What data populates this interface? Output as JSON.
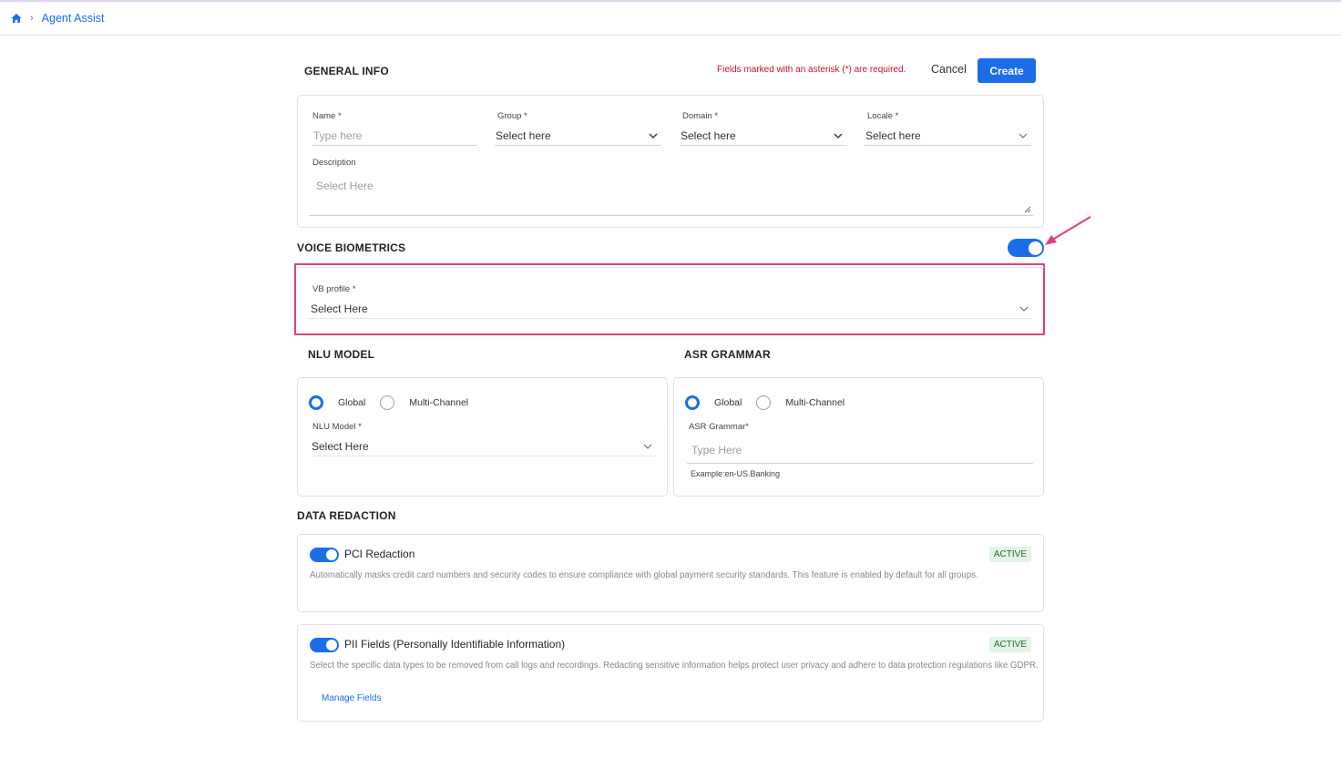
{
  "breadcrumb": {
    "home_icon": "home-icon",
    "current": "Agent Assist"
  },
  "general": {
    "title": "GENERAL INFO",
    "required_note": "Fields marked with an asterisk (*) are required.",
    "cancel_label": "Cancel",
    "create_label": "Create",
    "name": {
      "label": "Name *",
      "placeholder": "Type here"
    },
    "group": {
      "label": "Group *",
      "value": "Select here"
    },
    "domain": {
      "label": "Domain *",
      "value": "Select here"
    },
    "locale": {
      "label": "Locale *",
      "value": "Select here"
    },
    "description": {
      "label": "Description",
      "placeholder": "Select Here"
    }
  },
  "voice_biometrics": {
    "title": "VOICE BIOMETRICS",
    "enabled": true,
    "vb_profile": {
      "label": "VB profile *",
      "value": "Select Here"
    }
  },
  "nlu": {
    "title": "NLU MODEL",
    "options": [
      "Global",
      "Multi-Channel"
    ],
    "selected": "Global",
    "model": {
      "label": "NLU Model *",
      "value": "Select Here"
    }
  },
  "asr": {
    "title": "ASR GRAMMAR",
    "options": [
      "Global",
      "Multi-Channel"
    ],
    "selected": "Global",
    "grammar": {
      "label": "ASR Grammar*",
      "placeholder": "Type Here",
      "hint": "Example:en-US.Banking"
    }
  },
  "data_redaction": {
    "title": "DATA REDACTION",
    "pci": {
      "name": "PCI Redaction",
      "status": "ACTIVE",
      "enabled": true,
      "description": "Automatically masks credit card numbers and security codes to ensure compliance with global payment security standards. This feature is enabled by default for all groups."
    },
    "pii": {
      "name": "PII Fields (Personally Identifiable Information)",
      "status": "ACTIVE",
      "enabled": true,
      "description": "Select the specific data types to be removed from call logs and recordings. Redacting sensitive information helps protect user privacy and adhere to data protection regulations like GDPR.",
      "manage_label": "Manage Fields"
    }
  },
  "colors": {
    "accent": "#1a6fe8",
    "highlight": "#e0407a",
    "required": "#c8102e",
    "badge_bg": "#e3f5e6"
  }
}
